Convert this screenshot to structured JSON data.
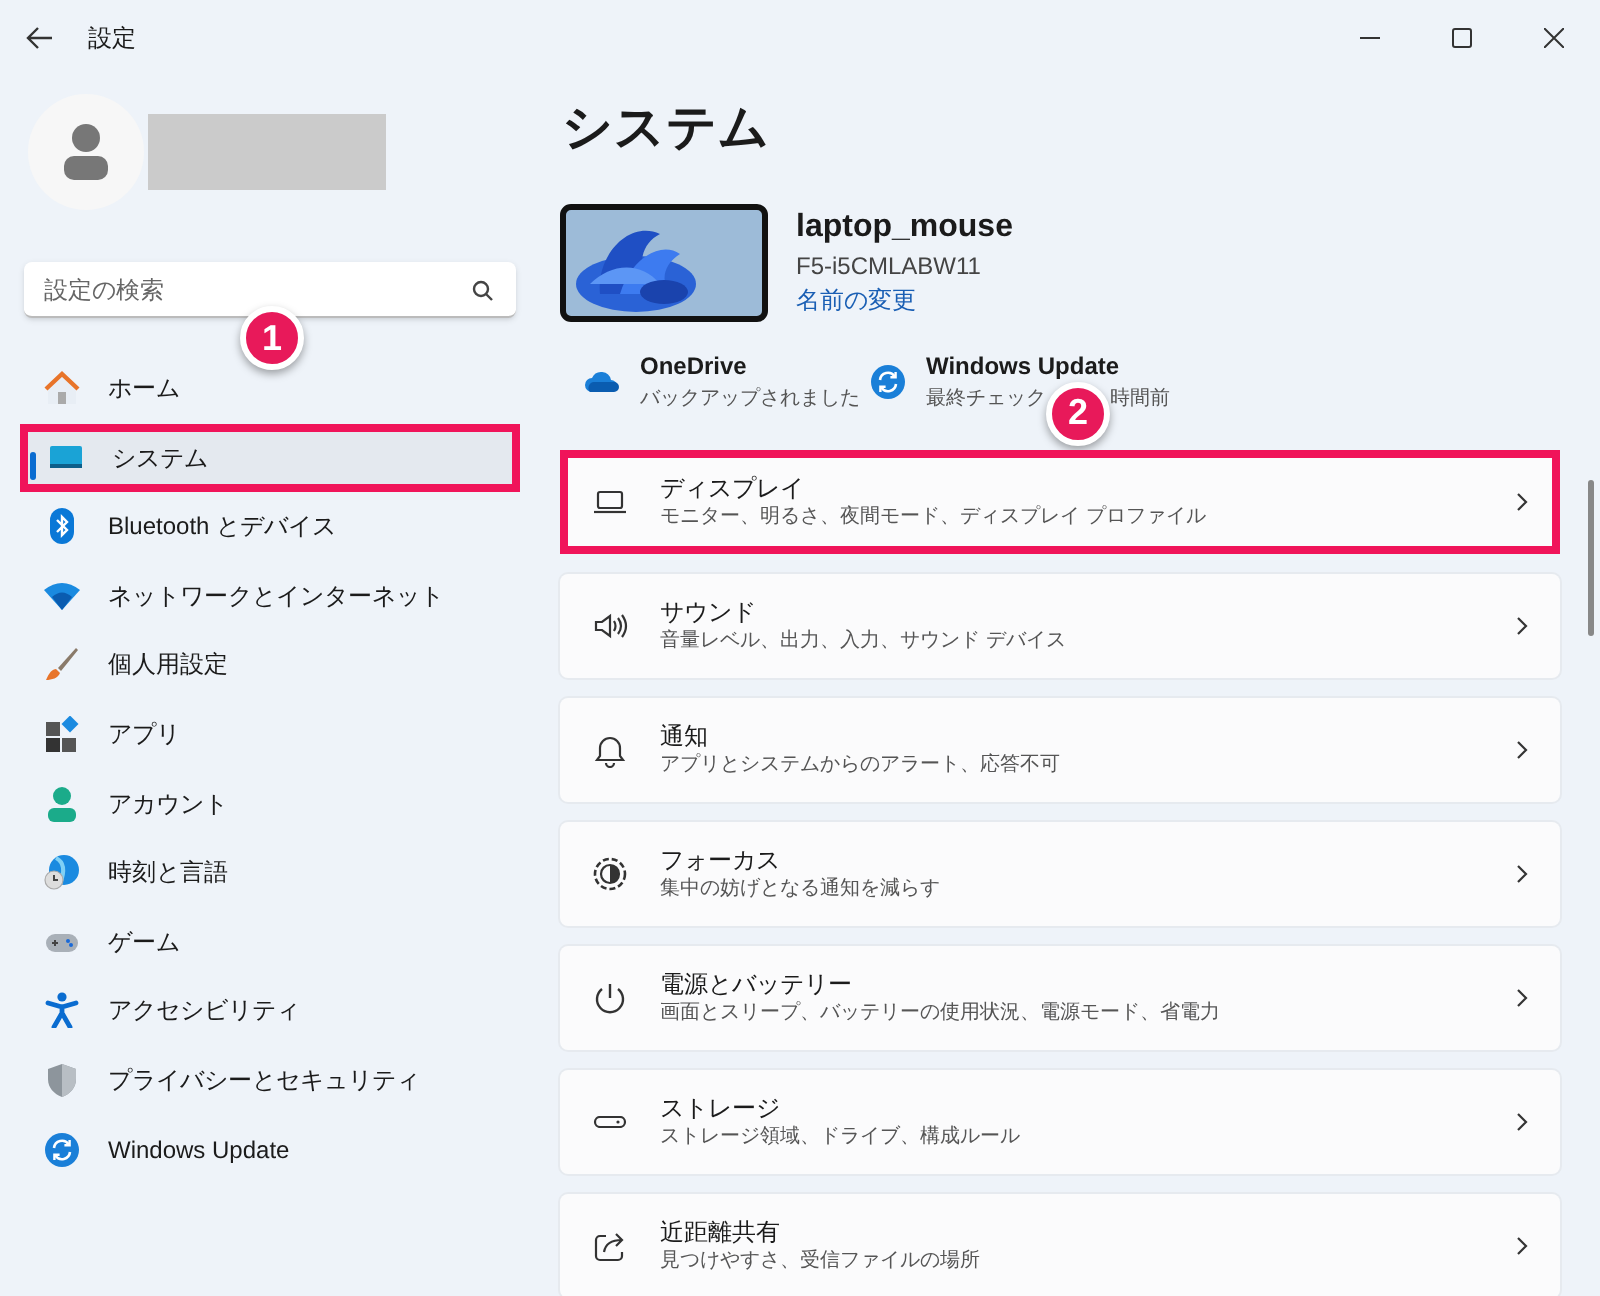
{
  "window": {
    "title": "設定"
  },
  "search": {
    "placeholder": "設定の検索"
  },
  "nav": [
    {
      "label": "ホーム",
      "selected": false,
      "highlighted": false
    },
    {
      "label": "システム",
      "selected": true,
      "highlighted": true
    },
    {
      "label": "Bluetooth とデバイス",
      "selected": false,
      "highlighted": false
    },
    {
      "label": "ネットワークとインターネット",
      "selected": false,
      "highlighted": false
    },
    {
      "label": "個人用設定",
      "selected": false,
      "highlighted": false
    },
    {
      "label": "アプリ",
      "selected": false,
      "highlighted": false
    },
    {
      "label": "アカウント",
      "selected": false,
      "highlighted": false
    },
    {
      "label": "時刻と言語",
      "selected": false,
      "highlighted": false
    },
    {
      "label": "ゲーム",
      "selected": false,
      "highlighted": false
    },
    {
      "label": "アクセシビリティ",
      "selected": false,
      "highlighted": false
    },
    {
      "label": "プライバシーとセキュリティ",
      "selected": false,
      "highlighted": false
    },
    {
      "label": "Windows Update",
      "selected": false,
      "highlighted": false
    }
  ],
  "page_title": "システム",
  "device": {
    "name": "laptop_mouse",
    "model": "F5-i5CMLABW11",
    "rename_link": "名前の変更"
  },
  "status": [
    {
      "title": "OneDrive",
      "subtitle_parts": [
        "バックアップされました"
      ]
    },
    {
      "title": "Windows Update",
      "subtitle_parts": [
        "最終チェック",
        "時間前"
      ]
    }
  ],
  "cards": [
    {
      "title": "ディスプレイ",
      "subtitle": "モニター、明るさ、夜間モード、ディスプレイ プロファイル",
      "highlighted": true
    },
    {
      "title": "サウンド",
      "subtitle": "音量レベル、出力、入力、サウンド デバイス",
      "highlighted": false
    },
    {
      "title": "通知",
      "subtitle": "アプリとシステムからのアラート、応答不可",
      "highlighted": false
    },
    {
      "title": "フォーカス",
      "subtitle": "集中の妨げとなる通知を減らす",
      "highlighted": false
    },
    {
      "title": "電源とバッテリー",
      "subtitle": "画面とスリープ、バッテリーの使用状況、電源モード、省電力",
      "highlighted": false
    },
    {
      "title": "ストレージ",
      "subtitle": "ストレージ領域、ドライブ、構成ルール",
      "highlighted": false
    },
    {
      "title": "近距離共有",
      "subtitle": "見つけやすさ、受信ファイルの場所",
      "highlighted": false
    }
  ],
  "annotations": [
    {
      "label": "1"
    },
    {
      "label": "2"
    }
  ]
}
